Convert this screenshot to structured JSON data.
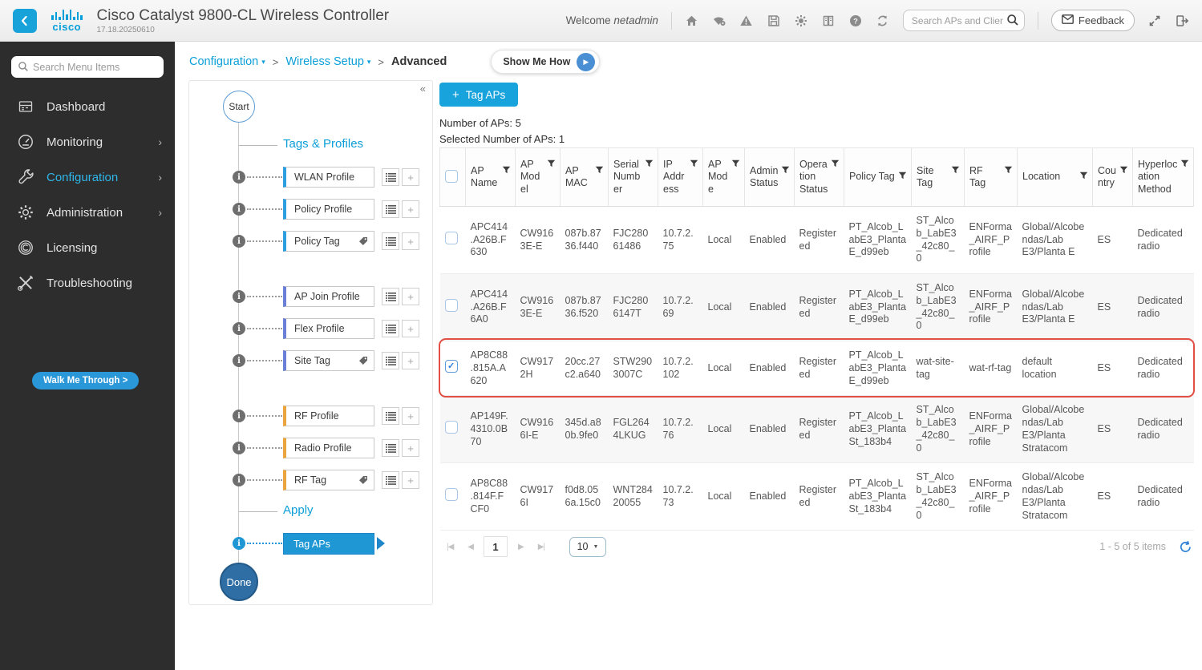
{
  "header": {
    "brand": "cisco",
    "title": "Cisco Catalyst 9800-CL Wireless Controller",
    "version": "17.18.20250610",
    "welcome": "Welcome",
    "username": "netadmin",
    "search_placeholder": "Search APs and Clients",
    "feedback": "Feedback",
    "toolbar_icons": [
      "home",
      "wireless-settings",
      "alerts",
      "save",
      "settings",
      "audit",
      "help",
      "sync"
    ],
    "window_icons": [
      "fullscreen",
      "logout"
    ]
  },
  "sidebar": {
    "search_placeholder": "Search Menu Items",
    "items": [
      {
        "label": "Dashboard",
        "icon": "dashboard",
        "chevron": false,
        "active": false
      },
      {
        "label": "Monitoring",
        "icon": "monitoring",
        "chevron": true,
        "active": false
      },
      {
        "label": "Configuration",
        "icon": "configuration",
        "chevron": true,
        "active": true
      },
      {
        "label": "Administration",
        "icon": "administration",
        "chevron": true,
        "active": false
      },
      {
        "label": "Licensing",
        "icon": "licensing",
        "chevron": false,
        "active": false
      },
      {
        "label": "Troubleshooting",
        "icon": "troubleshooting",
        "chevron": false,
        "active": false
      }
    ],
    "walkthrough": "Walk Me Through >"
  },
  "breadcrumb": {
    "links": [
      "Configuration",
      "Wireless Setup"
    ],
    "current": "Advanced",
    "caret": "▾",
    "separator": ">",
    "show_me_how": "Show Me How",
    "show_me_how_arrow": "▶"
  },
  "wizard": {
    "collapse": "«",
    "start": "Start",
    "done": "Done",
    "flow": [
      {
        "kind": "heading",
        "label": "Tags & Profiles"
      },
      {
        "kind": "step",
        "label": "WLAN Profile",
        "group": "blue",
        "tag": false
      },
      {
        "kind": "step",
        "label": "Policy Profile",
        "group": "blue",
        "tag": false
      },
      {
        "kind": "step",
        "label": "Policy Tag",
        "group": "blue",
        "tag": true
      },
      {
        "kind": "step",
        "label": "AP Join Profile",
        "group": "indigo",
        "tag": false
      },
      {
        "kind": "step",
        "label": "Flex Profile",
        "group": "indigo",
        "tag": false
      },
      {
        "kind": "step",
        "label": "Site Tag",
        "group": "indigo",
        "tag": true
      },
      {
        "kind": "step",
        "label": "RF Profile",
        "group": "orange",
        "tag": false
      },
      {
        "kind": "step",
        "label": "Radio Profile",
        "group": "orange",
        "tag": false
      },
      {
        "kind": "step",
        "label": "RF Tag",
        "group": "orange",
        "tag": true
      },
      {
        "kind": "heading",
        "label": "Apply"
      },
      {
        "kind": "action",
        "label": "Tag APs"
      }
    ],
    "group_colors": {
      "blue": "#2b9fe0",
      "indigo": "#6b7fd7",
      "orange": "#eaa53e"
    }
  },
  "main": {
    "tag_aps_plus": "+",
    "tag_aps_button": "Tag APs",
    "number_of_aps": "Number of APs: 5",
    "selected_number": "Selected Number of APs: 1",
    "table": {
      "columns": [
        {
          "label": "",
          "filter": false
        },
        {
          "label": "AP Name",
          "filter": true
        },
        {
          "label": "AP Model",
          "filter": true
        },
        {
          "label": "AP MAC",
          "filter": true
        },
        {
          "label": "Serial Number",
          "filter": true
        },
        {
          "label": "IP Address",
          "filter": true
        },
        {
          "label": "AP Mode",
          "filter": true
        },
        {
          "label": "Admin Status",
          "filter": true
        },
        {
          "label": "Operation Status",
          "filter": true
        },
        {
          "label": "Policy Tag",
          "filter": true
        },
        {
          "label": "Site Tag",
          "filter": true
        },
        {
          "label": "RF Tag",
          "filter": true
        },
        {
          "label": "Location",
          "filter": true
        },
        {
          "label": "Country",
          "filter": true
        },
        {
          "label": "Hyperlocation Method",
          "filter": true
        }
      ],
      "rows": [
        {
          "checked": false,
          "selected": false,
          "cells": [
            "APC414.A26B.F630",
            "CW9163E-E",
            "087b.8736.f440",
            "FJC28061486",
            "10.7.2.75",
            "Local",
            "Enabled",
            "Registered",
            "PT_Alcob_LabE3_PlantaE_d99eb",
            "ST_Alcob_LabE3_42c80_0",
            "ENForma_AIRF_Profile",
            "Global/Alcobendas/Lab E3/Planta E",
            "ES",
            "Dedicated radio"
          ]
        },
        {
          "checked": false,
          "selected": false,
          "cells": [
            "APC414.A26B.F6A0",
            "CW9163E-E",
            "087b.8736.f520",
            "FJC2806147T",
            "10.7.2.69",
            "Local",
            "Enabled",
            "Registered",
            "PT_Alcob_LabE3_PlantaE_d99eb",
            "ST_Alcob_LabE3_42c80_0",
            "ENForma_AIRF_Profile",
            "Global/Alcobendas/Lab E3/Planta E",
            "ES",
            "Dedicated radio"
          ]
        },
        {
          "checked": true,
          "selected": true,
          "cells": [
            "AP8C88.815A.A620",
            "CW9172H",
            "20cc.27c2.a640",
            "STW2903007C",
            "10.7.2.102",
            "Local",
            "Enabled",
            "Registered",
            "PT_Alcob_LabE3_PlantaE_d99eb",
            "wat-site-tag",
            "wat-rf-tag",
            "default location",
            "ES",
            "Dedicated radio"
          ]
        },
        {
          "checked": false,
          "selected": false,
          "cells": [
            "AP149F.4310.0B70",
            "CW9166I-E",
            "345d.a80b.9fe0",
            "FGL2644LKUG",
            "10.7.2.76",
            "Local",
            "Enabled",
            "Registered",
            "PT_Alcob_LabE3_PlantaSt_183b4",
            "ST_Alcob_LabE3_42c80_0",
            "ENForma_AIRF_Profile",
            "Global/Alcobendas/Lab E3/Planta Stratacom",
            "ES",
            "Dedicated radio"
          ]
        },
        {
          "checked": false,
          "selected": false,
          "cells": [
            "AP8C88.814F.FCF0",
            "CW9176I",
            "f0d8.056a.15c0",
            "WNT28420055",
            "10.7.2.73",
            "Local",
            "Enabled",
            "Registered",
            "PT_Alcob_LabE3_PlantaSt_183b4",
            "ST_Alcob_LabE3_42c80_0",
            "ENForma_AIRF_Profile",
            "Global/Alcobendas/Lab E3/Planta Stratacom",
            "ES",
            "Dedicated radio"
          ]
        }
      ]
    },
    "pagination": {
      "first": "|◀",
      "prev": "◀",
      "next": "▶",
      "last": "▶|",
      "page": "1",
      "page_size": "10",
      "size_caret": "▼",
      "range": "1 - 5 of 5 items"
    }
  },
  "colors": {
    "accent_blue": "#049fd9",
    "selected_row_outline": "#e25045",
    "sidebar_bg": "#2d2d2e",
    "active_nav": "#2fb7e9",
    "tag_aps_button": "#18a3dc",
    "done_circle": "#2f6ea5"
  }
}
